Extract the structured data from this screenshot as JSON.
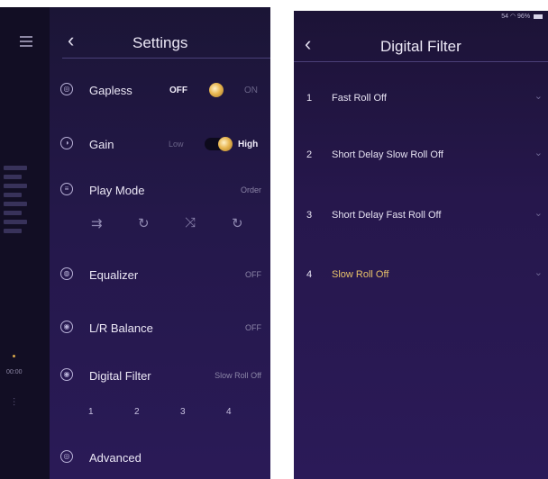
{
  "settings": {
    "title": "Settings",
    "gapless": {
      "label": "Gapless",
      "off_label": "OFF",
      "on_label": "ON",
      "state": "OFF"
    },
    "gain": {
      "label": "Gain",
      "low_label": "Low",
      "high_label": "High",
      "state": "High"
    },
    "play_mode": {
      "label": "Play Mode",
      "value": "Order",
      "icons": [
        "repeat-list-icon",
        "repeat-one-icon",
        "shuffle-icon",
        "repeat-all-icon"
      ]
    },
    "equalizer": {
      "label": "Equalizer",
      "value": "OFF"
    },
    "lr_balance": {
      "label": "L/R Balance",
      "value": "OFF"
    },
    "digital_filter": {
      "label": "Digital Filter",
      "value": "Slow Roll Off",
      "quick": [
        "1",
        "2",
        "3",
        "4"
      ]
    },
    "advanced": {
      "label": "Advanced"
    }
  },
  "sidebar": {
    "time": "00:00"
  },
  "filter_screen": {
    "title": "Digital Filter",
    "status": "54",
    "battery": "96%",
    "items": [
      {
        "num": "1",
        "name": "Fast Roll Off"
      },
      {
        "num": "2",
        "name": "Short Delay Slow Roll Off"
      },
      {
        "num": "3",
        "name": "Short Delay Fast Roll Off"
      },
      {
        "num": "4",
        "name": "Slow Roll Off",
        "selected": true
      }
    ]
  },
  "colors": {
    "accent": "#e8c26a",
    "background": "#24184a",
    "sidebar": "#120e24"
  }
}
